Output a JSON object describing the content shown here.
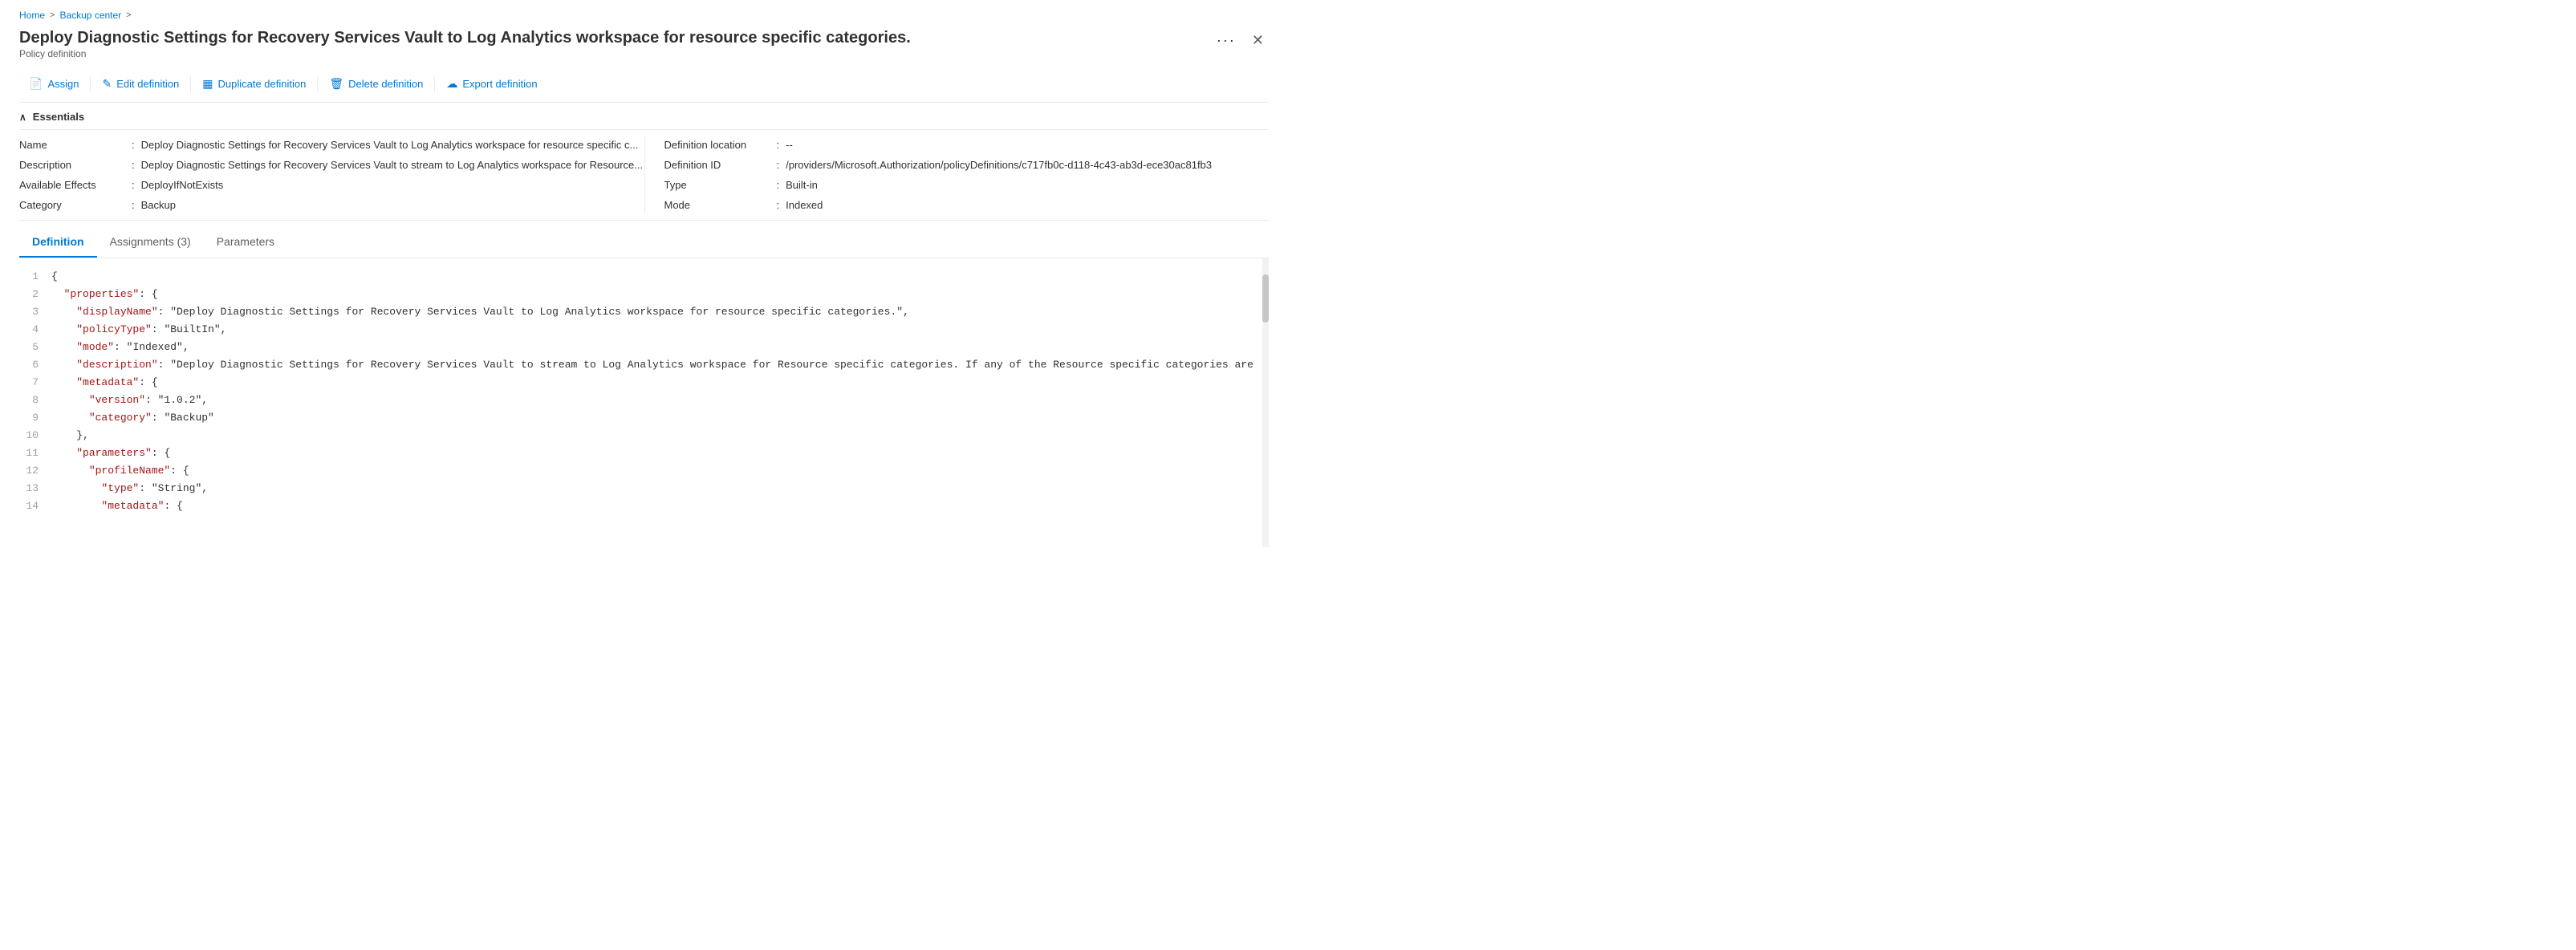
{
  "breadcrumb": {
    "home": "Home",
    "backup": "Backup center",
    "separator1": ">",
    "separator2": ">"
  },
  "header": {
    "title": "Deploy Diagnostic Settings for Recovery Services Vault to Log Analytics workspace for resource specific categories.",
    "subtitle": "Policy definition",
    "more_label": "···",
    "close_label": "✕"
  },
  "toolbar": {
    "assign_label": "Assign",
    "edit_label": "Edit definition",
    "duplicate_label": "Duplicate definition",
    "delete_label": "Delete definition",
    "export_label": "Export definition"
  },
  "essentials": {
    "section_label": "Essentials",
    "fields_left": [
      {
        "label": "Name",
        "value": "Deploy Diagnostic Settings for Recovery Services Vault to Log Analytics workspace for resource specific c..."
      },
      {
        "label": "Description",
        "value": "Deploy Diagnostic Settings for Recovery Services Vault to stream to Log Analytics workspace for Resource..."
      },
      {
        "label": "Available Effects",
        "value": "DeployIfNotExists"
      },
      {
        "label": "Category",
        "value": "Backup"
      }
    ],
    "fields_right": [
      {
        "label": "Definition location",
        "value": "--"
      },
      {
        "label": "Definition ID",
        "value": "/providers/Microsoft.Authorization/policyDefinitions/c717fb0c-d118-4c43-ab3d-ece30ac81fb3"
      },
      {
        "label": "Type",
        "value": "Built-in"
      },
      {
        "label": "Mode",
        "value": "Indexed"
      }
    ]
  },
  "tabs": [
    {
      "label": "Definition",
      "active": true
    },
    {
      "label": "Assignments (3)",
      "active": false
    },
    {
      "label": "Parameters",
      "active": false
    }
  ],
  "code": {
    "lines": [
      {
        "num": 1,
        "content": "{"
      },
      {
        "num": 2,
        "content": "  \"properties\": {"
      },
      {
        "num": 3,
        "content": "    \"displayName\": \"Deploy Diagnostic Settings for Recovery Services Vault to Log Analytics workspace for resource specific categories.\","
      },
      {
        "num": 4,
        "content": "    \"policyType\": \"BuiltIn\","
      },
      {
        "num": 5,
        "content": "    \"mode\": \"Indexed\","
      },
      {
        "num": 6,
        "content": "    \"description\": \"Deploy Diagnostic Settings for Recovery Services Vault to stream to Log Analytics workspace for Resource specific categories. If any of the Resource specific categories are"
      },
      {
        "num": 7,
        "content": "    \"metadata\": {"
      },
      {
        "num": 8,
        "content": "      \"version\": \"1.0.2\","
      },
      {
        "num": 9,
        "content": "      \"category\": \"Backup\""
      },
      {
        "num": 10,
        "content": "    },"
      },
      {
        "num": 11,
        "content": "    \"parameters\": {"
      },
      {
        "num": 12,
        "content": "      \"profileName\": {"
      },
      {
        "num": 13,
        "content": "        \"type\": \"String\","
      },
      {
        "num": 14,
        "content": "        \"metadata\": {"
      }
    ]
  }
}
